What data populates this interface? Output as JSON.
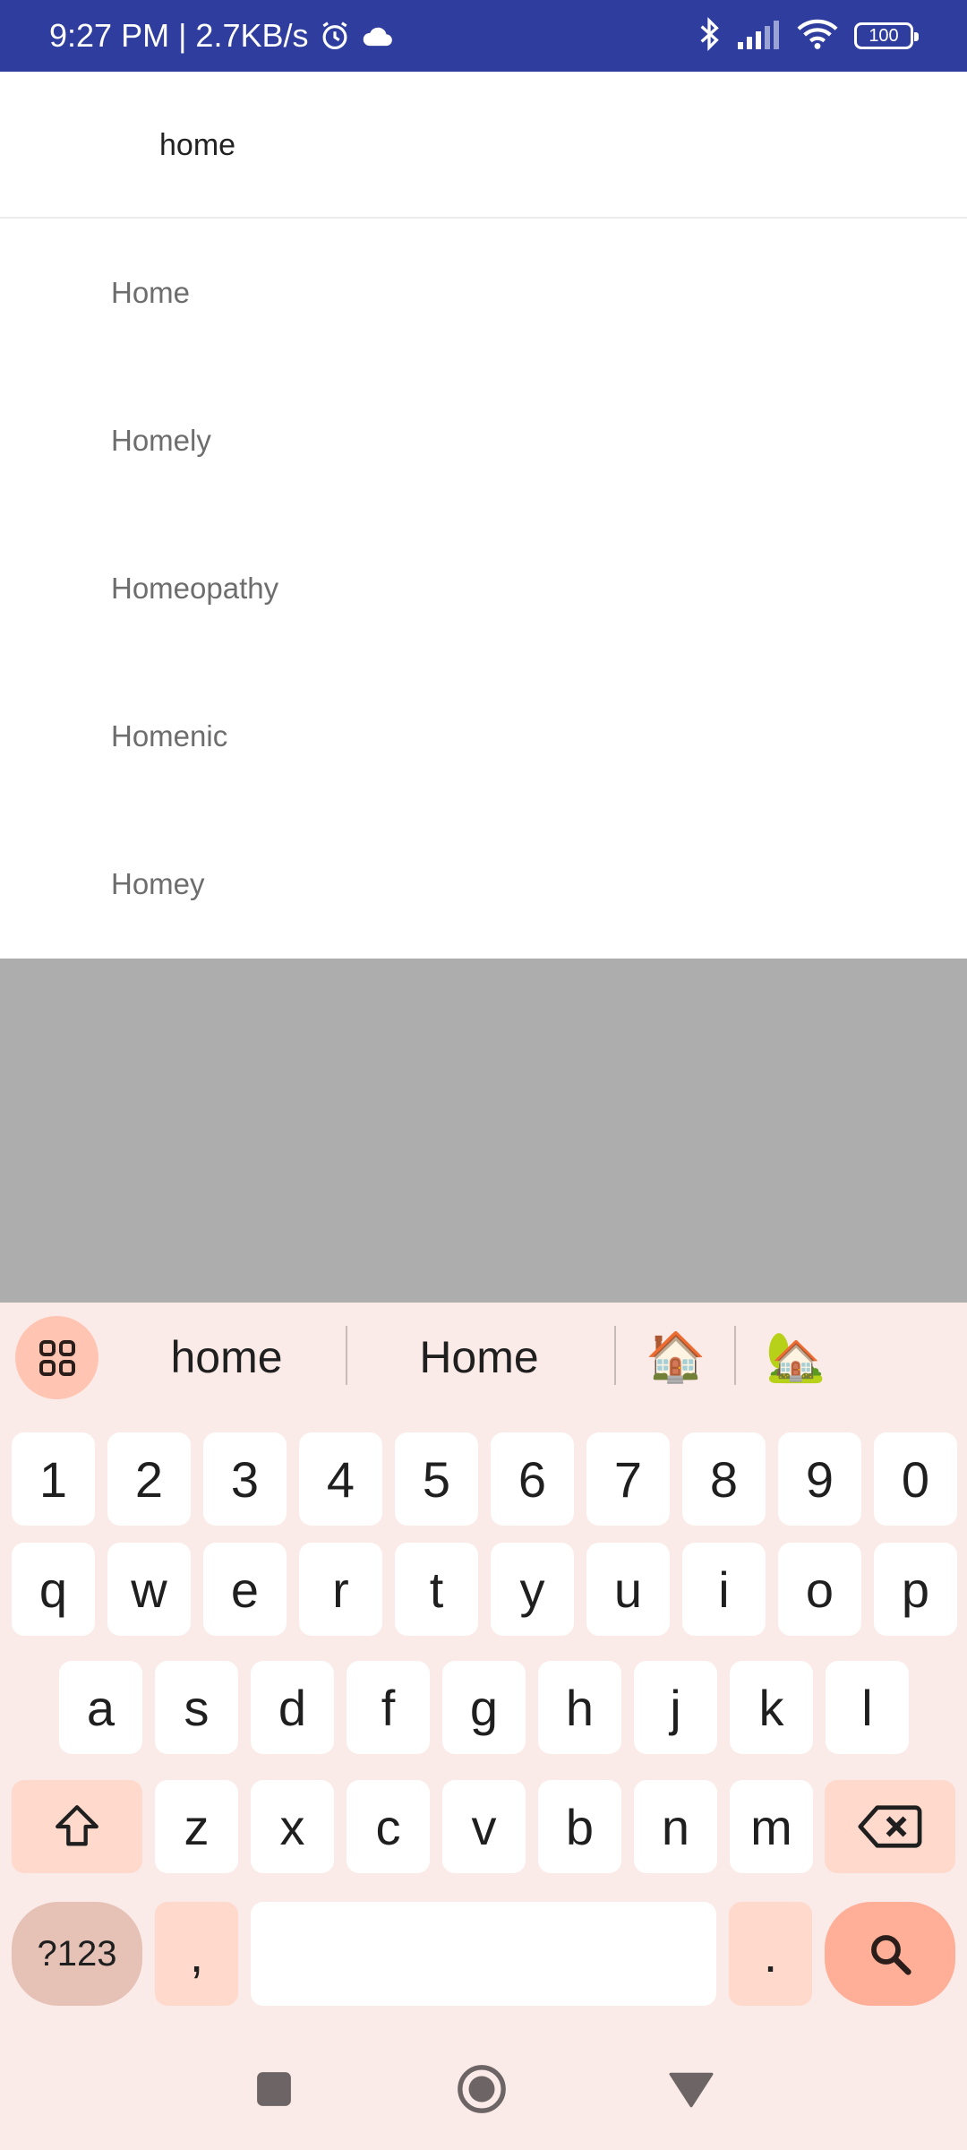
{
  "status_bar": {
    "time_speed": "9:27 PM | 2.7KB/s",
    "battery": "100",
    "icons": [
      "alarm-icon",
      "cloud-icon",
      "bluetooth-icon",
      "signal-icon",
      "wifi-icon",
      "battery-icon"
    ]
  },
  "search": {
    "value": "home"
  },
  "suggestions": [
    "Home",
    "Homely",
    "Homeopathy",
    "Homenic",
    "Homey"
  ],
  "keyboard": {
    "suggestion_strip": {
      "words": [
        "home",
        "Home"
      ],
      "emoji": [
        "🏠",
        "🏡"
      ]
    },
    "rows": {
      "numbers": [
        "1",
        "2",
        "3",
        "4",
        "5",
        "6",
        "7",
        "8",
        "9",
        "0"
      ],
      "row1": [
        "q",
        "w",
        "e",
        "r",
        "t",
        "y",
        "u",
        "i",
        "o",
        "p"
      ],
      "row2": [
        "a",
        "s",
        "d",
        "f",
        "g",
        "h",
        "j",
        "k",
        "l"
      ],
      "row3": [
        "z",
        "x",
        "c",
        "v",
        "b",
        "n",
        "m"
      ]
    },
    "symbols_label": "?123",
    "comma": ",",
    "period": "."
  },
  "colors": {
    "status_bar": "#2f3d9e",
    "keyboard_bg": "#fbebe8",
    "key_bg": "#ffffff",
    "mod_key_bg": "#ffd9cc",
    "accent_key_bg": "#ffae97",
    "overlay": "#adadad"
  }
}
